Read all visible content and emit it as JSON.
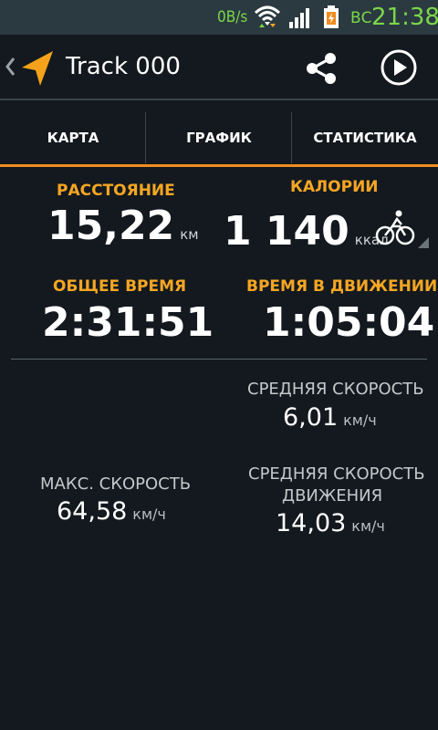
{
  "status_bar": {
    "net_speed": "0B/s",
    "day": "ВС",
    "time": "21:38",
    "accent_color": "#7bd64b",
    "icons": [
      "wifi-icon",
      "signal-icon",
      "battery-icon"
    ]
  },
  "action_bar": {
    "title": "Track 000",
    "icons": [
      "back-chevron-icon",
      "navigation-arrow-icon",
      "share-icon",
      "play-icon"
    ]
  },
  "tabs": [
    {
      "label": "КАРТА",
      "selected": false
    },
    {
      "label": "ГРАФИК",
      "selected": false
    },
    {
      "label": "СТАТИСТИКА",
      "selected": true
    }
  ],
  "colors": {
    "accent": "#f28c1e",
    "label_orange": "#f5a623",
    "background": "#13191e"
  },
  "stats": {
    "distance": {
      "label": "РАССТОЯНИЕ",
      "value": "15,22",
      "unit": "км"
    },
    "calories": {
      "label": "КАЛОРИИ",
      "value": "1 140",
      "unit": "ккал",
      "activity_icon": "bicycle-icon"
    },
    "total_time": {
      "label": "ОБЩЕЕ ВРЕМЯ",
      "value": "2:31:51"
    },
    "moving_time": {
      "label": "ВРЕМЯ В ДВИЖЕНИИ",
      "value": "1:05:04"
    },
    "avg_speed": {
      "label": "СРЕДНЯЯ СКОРОСТЬ",
      "value": "6,01",
      "unit": "км/ч"
    },
    "max_speed": {
      "label": "МАКС. СКОРОСТЬ",
      "value": "64,58",
      "unit": "км/ч"
    },
    "avg_moving_speed": {
      "label_line1": "СРЕДНЯЯ СКОРОСТЬ",
      "label_line2": "ДВИЖЕНИЯ",
      "value": "14,03",
      "unit": "км/ч"
    }
  }
}
